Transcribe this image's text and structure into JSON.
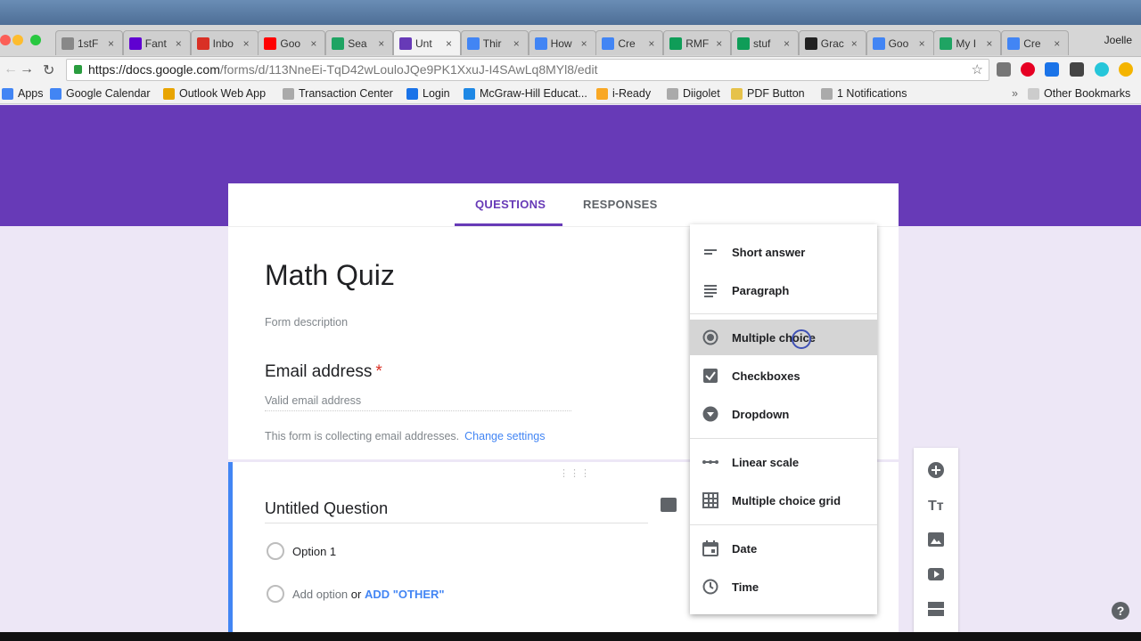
{
  "browser": {
    "tabs": [
      {
        "title": "1stF",
        "icon": "doc-icon",
        "color": "#888888"
      },
      {
        "title": "Fant",
        "icon": "yahoo-icon",
        "color": "#5f01d1"
      },
      {
        "title": "Inbo",
        "icon": "gmail-icon",
        "color": "#d93025"
      },
      {
        "title": "Goo",
        "icon": "youtube-icon",
        "color": "#ff0000"
      },
      {
        "title": "Sea",
        "icon": "drive-icon",
        "color": "#1fa463"
      },
      {
        "title": "Unt",
        "icon": "forms-icon",
        "color": "#673ab7"
      },
      {
        "title": "Thir",
        "icon": "docs-icon",
        "color": "#4285f4"
      },
      {
        "title": "How",
        "icon": "google-icon",
        "color": "#4285f4"
      },
      {
        "title": "Cre",
        "icon": "google-icon",
        "color": "#4285f4"
      },
      {
        "title": "RMF",
        "icon": "sheets-icon",
        "color": "#0f9d58"
      },
      {
        "title": "stuf",
        "icon": "sheets-icon",
        "color": "#0f9d58"
      },
      {
        "title": "Grac",
        "icon": "bb-icon",
        "color": "#222222"
      },
      {
        "title": "Goo",
        "icon": "calendar-icon",
        "color": "#4285f4"
      },
      {
        "title": "My I",
        "icon": "drive-icon",
        "color": "#1fa463"
      },
      {
        "title": "Cre",
        "icon": "google-icon",
        "color": "#4285f4"
      }
    ],
    "active_tab_index": 5,
    "profile_name": "Joelle",
    "url_host": "https://docs.google.com",
    "url_path": "/forms/d/113NneEi-TqD42wLouloJQe9PK1XxuJ-I4SAwLq8MYl8/edit",
    "bookmarks": [
      {
        "label": "Apps",
        "icon": "apps-grid-icon",
        "color": "#4285f4"
      },
      {
        "label": "Google Calendar",
        "icon": "calendar-icon",
        "color": "#4285f4"
      },
      {
        "label": "Outlook Web App",
        "icon": "outlook-icon",
        "color": "#e8a400"
      },
      {
        "label": "Transaction Center",
        "icon": "page-icon",
        "color": "#aaaaaa"
      },
      {
        "label": "Login",
        "icon": "login-icon",
        "color": "#1a73e8"
      },
      {
        "label": "McGraw-Hill Educat...",
        "icon": "mcgraw-icon",
        "color": "#1e88e5"
      },
      {
        "label": "i-Ready",
        "icon": "iready-icon",
        "color": "#f9a825"
      },
      {
        "label": "Diigolet",
        "icon": "page-icon",
        "color": "#aaaaaa"
      },
      {
        "label": "PDF Button",
        "icon": "folder-icon",
        "color": "#e6c24a"
      },
      {
        "label": "1 Notifications",
        "icon": "page-icon",
        "color": "#aaaaaa"
      }
    ],
    "other_bookmarks": "Other Bookmarks",
    "more_bookmarks": "»"
  },
  "form": {
    "tabs": {
      "questions": "QUESTIONS",
      "responses": "RESPONSES"
    },
    "title": "Math Quiz",
    "description_placeholder": "Form description",
    "email": {
      "label": "Email address",
      "required_mark": "*",
      "placeholder": "Valid email address",
      "collecting_note": "This form is collecting email addresses.",
      "change_link": "Change settings"
    },
    "question": {
      "title": "Untitled Question",
      "option1": "Option 1",
      "add_option": "Add option",
      "or": "or",
      "add_other": "ADD \"OTHER\""
    }
  },
  "type_menu": {
    "items": [
      {
        "label": "Short answer",
        "icon": "short-answer-icon"
      },
      {
        "label": "Paragraph",
        "icon": "paragraph-icon"
      },
      {
        "label": "Multiple choice",
        "icon": "radio-icon"
      },
      {
        "label": "Checkboxes",
        "icon": "checkbox-icon"
      },
      {
        "label": "Dropdown",
        "icon": "dropdown-icon"
      },
      {
        "label": "Linear scale",
        "icon": "linear-scale-icon"
      },
      {
        "label": "Multiple choice grid",
        "icon": "grid-icon"
      },
      {
        "label": "Date",
        "icon": "calendar-icon"
      },
      {
        "label": "Time",
        "icon": "clock-icon"
      }
    ],
    "selected": "Multiple choice"
  },
  "side_toolbar": [
    "add-question-icon",
    "add-title-icon",
    "add-image-icon",
    "add-video-icon",
    "add-section-icon"
  ],
  "help": "?",
  "colors": {
    "brand": "#673ab7",
    "accent_blue": "#4285f4",
    "required": "#d93025"
  }
}
